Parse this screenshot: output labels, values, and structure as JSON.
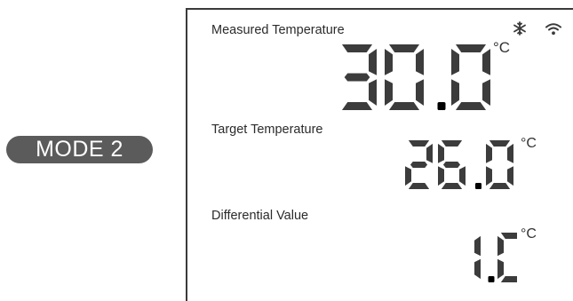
{
  "mode": {
    "label": "MODE 2"
  },
  "status_icons": {
    "snowflake": "snowflake-icon",
    "wifi": "wifi-icon"
  },
  "measured": {
    "label": "Measured Temperature",
    "value": "30.0",
    "unit": "°C"
  },
  "target": {
    "label": "Target Temperature",
    "value": "26.0",
    "unit": "°C"
  },
  "differential": {
    "label": "Differential Value",
    "value": "1.0",
    "unit": "°C"
  },
  "colors": {
    "badge": "#5b5b5b",
    "segment": "#3c3c3c",
    "frame": "#3a3a3a"
  }
}
